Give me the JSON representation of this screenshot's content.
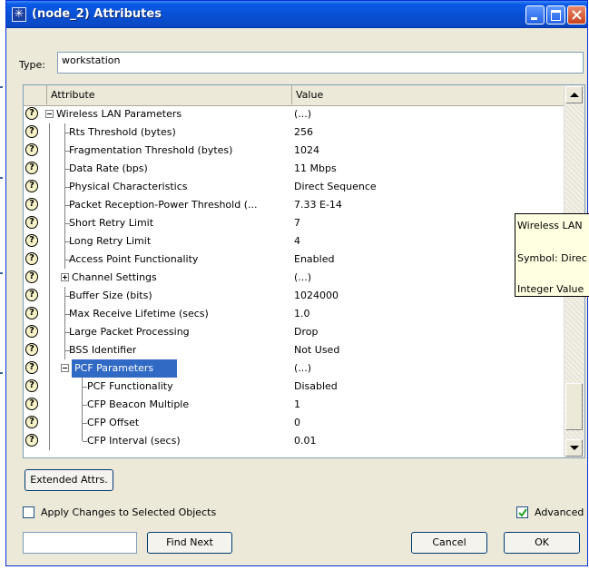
{
  "window": {
    "title": "(node_2) Attributes"
  },
  "type_field": {
    "label": "Type:",
    "value": "workstation"
  },
  "table": {
    "headers": {
      "attribute": "Attribute",
      "value": "Value"
    },
    "rows": [
      {
        "attr": "Wireless LAN Parameters",
        "val": "(...)"
      },
      {
        "attr": "Rts Threshold (bytes)",
        "val": "256"
      },
      {
        "attr": "Fragmentation Threshold (bytes)",
        "val": "1024"
      },
      {
        "attr": "Data Rate (bps)",
        "val": "11 Mbps"
      },
      {
        "attr": "Physical Characteristics",
        "val": "Direct Sequence"
      },
      {
        "attr": "Packet Reception-Power Threshold (...",
        "val": "7.33 E-14"
      },
      {
        "attr": "Short Retry Limit",
        "val": "7"
      },
      {
        "attr": "Long Retry Limit",
        "val": "4"
      },
      {
        "attr": "Access Point Functionality",
        "val": "Enabled"
      },
      {
        "attr": "Channel Settings",
        "val": "(...)"
      },
      {
        "attr": "Buffer Size (bits)",
        "val": "1024000"
      },
      {
        "attr": "Max Receive Lifetime (secs)",
        "val": "1.0"
      },
      {
        "attr": "Large Packet Processing",
        "val": "Drop"
      },
      {
        "attr": "BSS Identifier",
        "val": "Not Used"
      },
      {
        "attr": "PCF Parameters",
        "val": "(...)"
      },
      {
        "attr": "PCF Functionality",
        "val": "Disabled"
      },
      {
        "attr": "CFP Beacon Multiple",
        "val": "1"
      },
      {
        "attr": "CFP Offset",
        "val": "0"
      },
      {
        "attr": "CFP Interval (secs)",
        "val": "0.01"
      }
    ]
  },
  "tooltip": {
    "line1": "Wireless LAN",
    "line2": "Symbol: Direc",
    "line3": "Integer Value"
  },
  "buttons": {
    "extended": "Extended Attrs.",
    "find_next": "Find Next",
    "cancel": "Cancel",
    "ok": "OK"
  },
  "checkboxes": {
    "apply": "Apply Changes to Selected Objects",
    "advanced": "Advanced",
    "advanced_checked": true
  },
  "find": {
    "value": ""
  },
  "icons": {
    "help": "?",
    "title": "✳"
  }
}
